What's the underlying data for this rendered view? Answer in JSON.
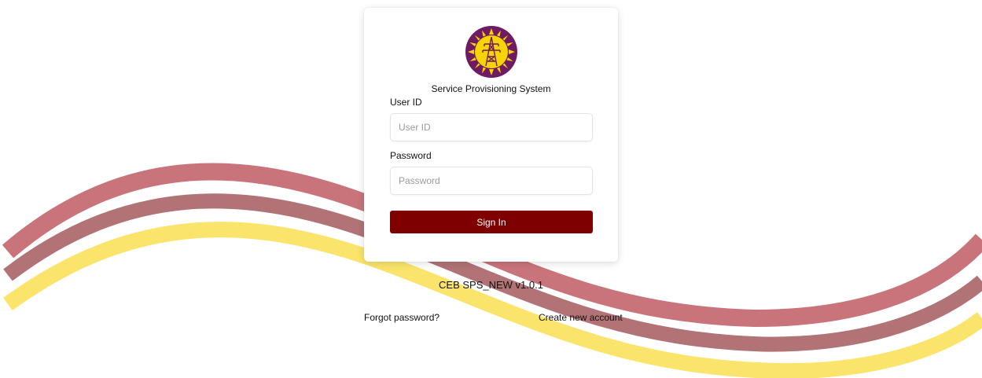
{
  "app": {
    "system_name": "Service Provisioning System",
    "version": "CEB SPS_NEW v1.0.1"
  },
  "form": {
    "user_id_label": "User ID",
    "user_id_placeholder": "User ID",
    "user_id_value": "",
    "password_label": "Password",
    "password_placeholder": "Password",
    "password_value": "",
    "sign_in_label": "Sign In"
  },
  "links": {
    "forgot_password": "Forgot password?",
    "create_account": "Create new account"
  },
  "colors": {
    "brand_maroon": "#7f0000",
    "wave_red": "#c9747b",
    "wave_mauve": "#b27376",
    "wave_yellow": "#fbe46b",
    "logo_purple": "#6f1a63",
    "logo_yellow": "#f5d400"
  },
  "icons": {
    "logo": "ceb-power-tower-logo"
  }
}
